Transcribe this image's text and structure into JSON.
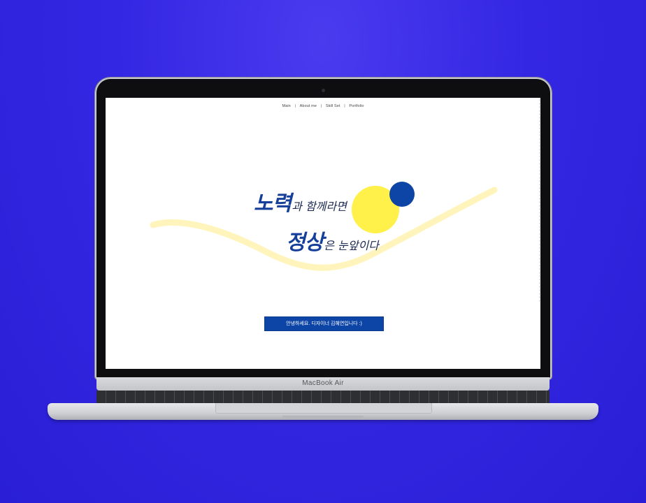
{
  "nav": {
    "items": [
      {
        "label": "Main"
      },
      {
        "label": "About me"
      },
      {
        "label": "Skill Set"
      },
      {
        "label": "Portfolio"
      }
    ],
    "separator": "|"
  },
  "hero": {
    "line1_big": "노력",
    "line1_small": "과 함께라면",
    "line2_big": "정상",
    "line2_small": "은 눈앞이다"
  },
  "cta": {
    "label": "안녕하세요. 디자이너 김혜연입니다 :)"
  },
  "laptop": {
    "brand": "MacBook Air"
  },
  "colors": {
    "background": "#3427e3",
    "accent_blue": "#0c45a6",
    "accent_yellow": "#fff04a",
    "stroke_yellow": "#fff4b8"
  }
}
